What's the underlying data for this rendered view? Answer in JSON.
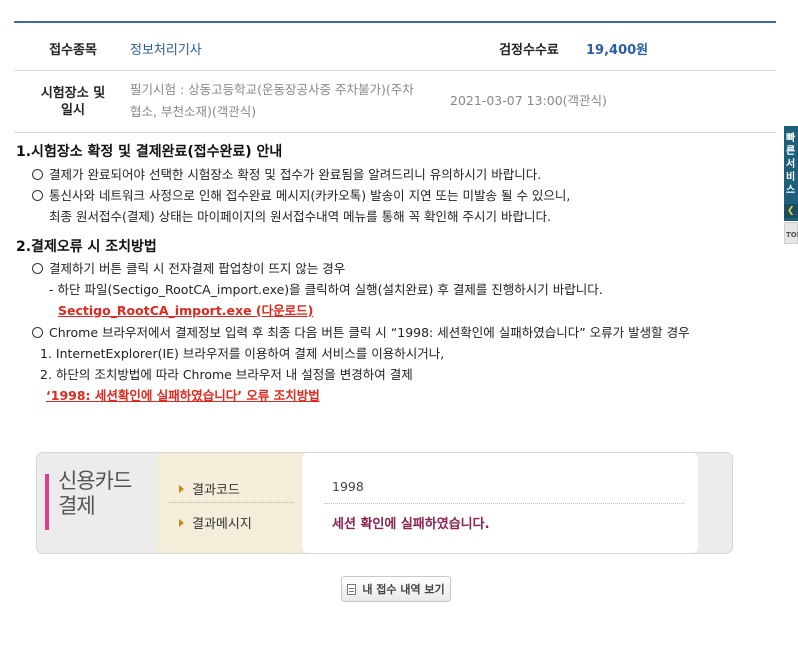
{
  "info": {
    "subject_label": "접수종목",
    "subject_value": "정보처리기사",
    "fee_label": "검정수수료",
    "fee_value": "19,400원",
    "place_label_line1": "시험장소 및",
    "place_label_line2": "일시",
    "place_value_line1": "필기시험 : 상동고등학교(운동장공사중 주차불가)(주차",
    "place_value_line2": "협소, 부천소재)(객관식)",
    "datetime_value": "2021-03-07 13:00(객관식)"
  },
  "section1": {
    "title": "1.시험장소 확정 및 결제완료(접수완료) 안내",
    "line1": "결제가 완료되어야 선택한 시험장소 확정 및 접수가 완료됨을 알려드리니 유의하시기 바랍니다.",
    "line2": "통신사와 네트워크 사정으로 인해 접수완료 메시지(카카오톡) 발송이 지연 또는 미발송 될 수 있으니,",
    "line3": "최종 원서접수(결제) 상태는 마이페이지의 원서접수내역 메뉴를 통해 꼭 확인해 주시기 바랍니다."
  },
  "section2": {
    "title": "2.결제오류 시 조치방법",
    "line1": "결제하기 버튼 클릭 시 전자결제 팝업창이 뜨지 않는 경우",
    "line2": "- 하단 파일(Sectigo_RootCA_import.exe)을 클릭하여 실행(설치완료) 후 결제를 진행하시기 바랍니다.",
    "download_link": "Sectigo_RootCA_import.exe (다운로드)",
    "line3": "Chrome 브라우저에서 결제정보 입력 후 최종 다음 버튼 클릭 시 “1998: 세션확인에 실패하였습니다” 오류가 발생할 경우",
    "line4": "1. InternetExplorer(IE) 브라우저를 이용하여 결제 서비스를 이용하시거나,",
    "line5": "2. 하단의 조치방법에 따라 Chrome 브라우저 내 설정을 변경하여 결제",
    "fix_link": "‘1998: 세션확인에 실패하였습니다’ 오류 조치방법"
  },
  "result": {
    "card_title_line1": "신용카드",
    "card_title_line2": "결제",
    "code_label": "결과코드",
    "message_label": "결과메시지",
    "code_value": "1998",
    "message_value": "세션 확인에 실패하였습니다."
  },
  "view_button_label": "내 접수 내역 보기",
  "side": {
    "banner_text": "빠른서비스",
    "top_label": "TOP"
  },
  "colors": {
    "accent_blue": "#2a5da3",
    "link_red": "#e0281e",
    "message_maroon": "#8a2150",
    "card_pink": "#e23a8c"
  }
}
